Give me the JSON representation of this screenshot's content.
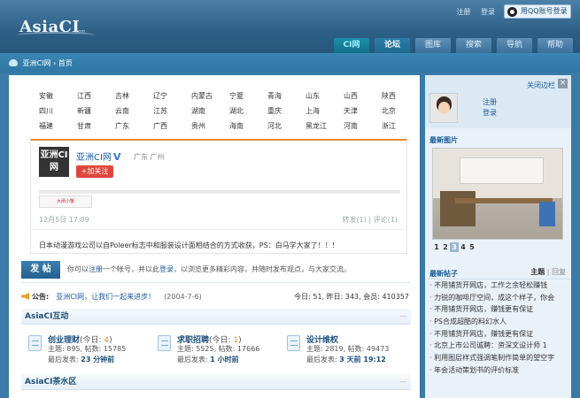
{
  "header": {
    "logo": "AsiaCI",
    "logo_sub": ".com",
    "top_links": [
      "注册",
      "登录"
    ],
    "qq_login": "用QQ账号登录",
    "nav": [
      "CI网",
      "论坛",
      "图库",
      "搜索",
      "导航",
      "帮助"
    ]
  },
  "breadcrumb": "亚洲CI网 › 首页",
  "provinces": [
    [
      "安徽",
      "江西",
      "吉林",
      "辽宁",
      "内蒙古",
      "宁夏",
      "青海",
      "山东",
      "山西",
      "陕西"
    ],
    [
      "四川",
      "新疆",
      "云南",
      "江苏",
      "湖南",
      "湖北",
      "重庆",
      "上海",
      "天津",
      "北京"
    ],
    [
      "福建",
      "甘肃",
      "广东",
      "广西",
      "贵州",
      "海南",
      "河北",
      "黑龙江",
      "河南",
      "浙江"
    ]
  ],
  "weibo": {
    "logo_text": "亚洲CI网",
    "name": "亚洲CI网",
    "location": "广东 广州",
    "follow": "+加关注",
    "thumb": "大闸小蟹",
    "time": "12月5日 17:09",
    "repost": "转发(1)",
    "comment": "评论(1)",
    "text": "日本动漫游戏公司以自Poleer标志中和服装设计面相结合的方式收获，PS：白马学大家了！！！"
  },
  "post": {
    "button": "发 帖",
    "hint_prefix": "你可以",
    "register": "注册",
    "hint_mid": "一个帐号，并以此",
    "login": "登录",
    "hint_suffix": "，以浏览更多精彩内容，并随时发布观点，与大家交流。"
  },
  "notice": {
    "label": "公告:",
    "text": "亚洲CI网，让我们一起来进步！",
    "date": "(2004-7-6)"
  },
  "stats": "今日: 51, 昨日: 343, 会员: 410357",
  "section1": {
    "title": "AsiaCI互动",
    "collapse": "—"
  },
  "forums": [
    {
      "title": "创业理财",
      "today_prefix": "(今日: ",
      "today": "4",
      "today_suffix": ")",
      "counts": "主题: 895, 帖数: 15785",
      "last_prefix": "最后发表: ",
      "last": "23 分钟前"
    },
    {
      "title": "求职招聘",
      "today_prefix": "(今日: ",
      "today": "1",
      "today_suffix": ")",
      "counts": "主题: 5525, 帖数: 17666",
      "last_prefix": "最后发表: ",
      "last": "1 小时前"
    },
    {
      "title": "设计维权",
      "today_prefix": "",
      "today": "",
      "today_suffix": "",
      "counts": "主题: 2819, 帖数: 49473",
      "last_prefix": "最后发表: ",
      "last": "3 天前 19:12"
    }
  ],
  "section2": {
    "title": "AsiaCI茶水区",
    "collapse": "—"
  },
  "sidebar": {
    "close_nav": "关闭边栏",
    "register": "注册",
    "login": "登录",
    "latest_images": "最新图片",
    "pages": [
      "1",
      "2",
      "3",
      "4",
      "5"
    ],
    "current_page": "3",
    "latest_posts": "最新帖子",
    "tab_topic": "主题",
    "tab_reply": "回复",
    "posts": [
      "不用铺货开网店，工作之余轻松赚钱",
      "力锐的咖啡厅空间，成这个样子，你会",
      "不用铺货开网店，赚钱更有保证",
      "PS合成超酷的料幻水人",
      "不用铺货开网店，赚钱更有保证",
      "北京上市公司诚聘：资深文设计师 1",
      "利用图层样式强调笔制作简单的望空字",
      "年会活动策划书的评价标准"
    ]
  }
}
